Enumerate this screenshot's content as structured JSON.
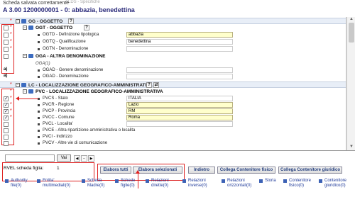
{
  "header": {
    "message": "Scheda salvata correttamente",
    "title": "A 3.00 1200000001 - 0: abbazia, benedettina",
    "faded_text": "ALDS - Specifiche"
  },
  "sections": {
    "og": {
      "label": "OG - OGGETTO",
      "help": "?"
    },
    "ogt": {
      "label": "OGT - OGGETTO",
      "help": "?"
    },
    "oga": {
      "label": "OGA - ALTRA DENOMINAZIONE"
    },
    "oga_sub": "OGA(1)",
    "lc": {
      "label": "LC - LOCALIZZAZIONE GEOGRAFICO-AMMINISTRATIVA",
      "help": "?"
    },
    "pvc": {
      "label": "PVC - LOCALIZZAZIONE GEOGRAFICO-AMMINISTRATIVA"
    }
  },
  "fields": {
    "ogtd": {
      "label": "OGTD - Definizione tipologica",
      "value": "abbazia"
    },
    "ogtq": {
      "label": "OGTQ - Qualificazione",
      "value": "benedettina"
    },
    "ogtn": {
      "label": "OGTN - Denominazione",
      "value": ""
    },
    "ogad": {
      "label": "OGAD - Genere denominazione",
      "value": ""
    },
    "ogad2": {
      "label": "OGAD - Denominazione",
      "value": ""
    },
    "pvcs": {
      "label": "PVCS - Stato",
      "value": "ITALIA"
    },
    "pvcr": {
      "label": "PVCR - Regione",
      "value": "Lazio"
    },
    "pvcp": {
      "label": "PVCP - Provincia",
      "value": "RM"
    },
    "pvcc": {
      "label": "PVCC - Comune",
      "value": "Roma"
    },
    "pvcl": {
      "label": "PVCL - Localita'",
      "value": ""
    },
    "pvce": {
      "label": "PVCE - Altra ripartizione amministrativa o localita",
      "value": ""
    },
    "pvci": {
      "label": "PVCI - Indirizzo",
      "value": ""
    },
    "pvcv": {
      "label": "PVCV - Altre vie di comunicazione",
      "value": ""
    }
  },
  "marks": {
    "a": "a)"
  },
  "toolbar": {
    "search_value": "",
    "go_label": "Vai",
    "rvel_label": "RVEL scheda figlia:",
    "rvel_value": "1",
    "elabora_tutti": "Elabora tutti",
    "elabora_selezionati": "Elabora selezionati",
    "indietro": "Indietro",
    "collega_fisico": "Collega Contenitore fisico",
    "collega_giuridico": "Collega Contenitore giuridico"
  },
  "footer_links": [
    {
      "line1": "Authority",
      "line2": "file(0)"
    },
    {
      "line1": "Entita'",
      "line2": "multimediali(0)"
    },
    {
      "line1": "Scheda",
      "line2": "Madre(0)"
    },
    {
      "line1": "Schede",
      "line2": "figlie(0)"
    },
    {
      "line1": "Relazioni",
      "line2": "dirette(0)"
    },
    {
      "line1": "Relazioni",
      "line2": "inverse(0)"
    },
    {
      "line1": "Relazioni",
      "line2": "orizzontali(0)"
    },
    {
      "line1": "Storia",
      "line2": ""
    },
    {
      "line1": "Contenitore",
      "line2": "fisico(0)"
    },
    {
      "line1": "Contenitore",
      "line2": "giuridico(0)"
    }
  ],
  "colors": {
    "accent": "#1f3a7a",
    "highlight_field": "#ffffcc",
    "annotation": "#e02020",
    "section_bg": "#e8eef7"
  }
}
